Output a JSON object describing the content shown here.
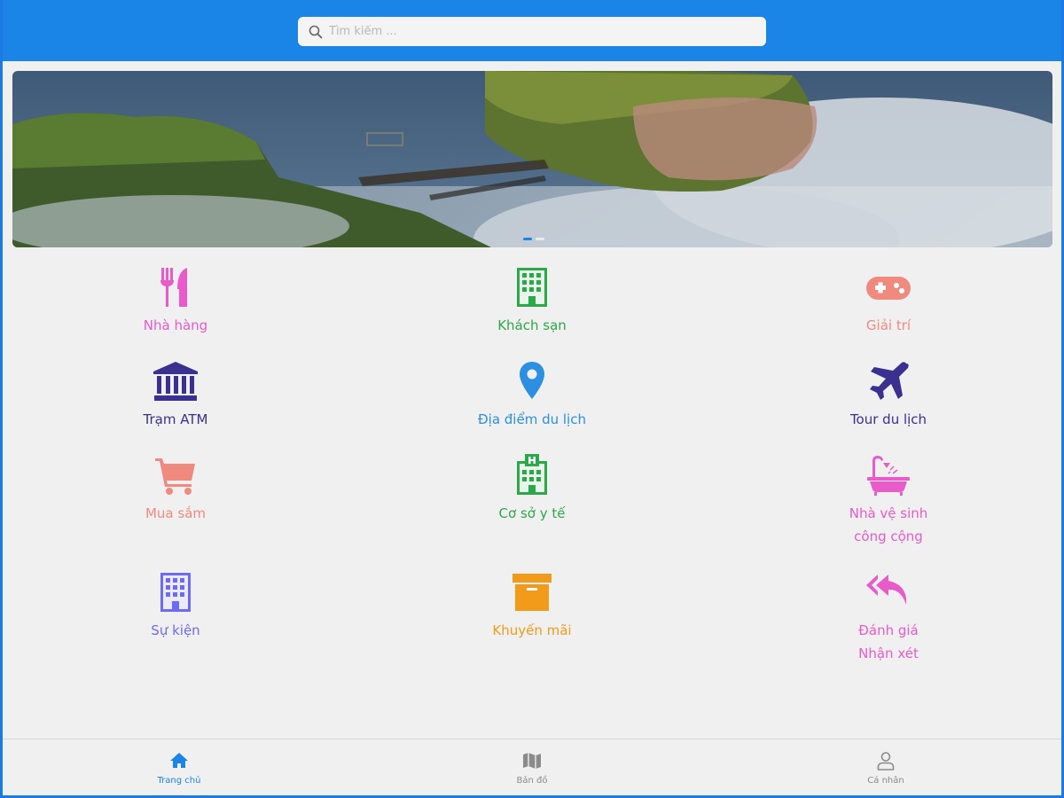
{
  "search": {
    "placeholder": "Tìm kiếm ..."
  },
  "banner": {
    "slide_count": 2,
    "active_slide": 1
  },
  "categories": [
    {
      "label": "Nhà hàng",
      "icon": "utensils-icon",
      "color": "#e85bc8"
    },
    {
      "label": "Khách sạn",
      "icon": "hotel-building-icon",
      "color": "#2ca84a"
    },
    {
      "label": "Giải trí",
      "icon": "gamepad-icon",
      "color": "#f08a7e"
    },
    {
      "label": "Trạm ATM",
      "icon": "bank-icon",
      "color": "#3b2f8f"
    },
    {
      "label": "Địa điểm du lịch",
      "icon": "map-pin-icon",
      "color": "#2c8fe0"
    },
    {
      "label": "Tour du lịch",
      "icon": "airplane-icon",
      "color": "#3b2f8f"
    },
    {
      "label": "Mua sắm",
      "icon": "shopping-cart-icon",
      "color": "#f08a7e"
    },
    {
      "label": "Cơ sở y tế",
      "icon": "hospital-icon",
      "color": "#2ca84a"
    },
    {
      "label": "Nhà vệ sinh\ncông cộng",
      "icon": "bathtub-icon",
      "color": "#e85bc8"
    },
    {
      "label": "Sự kiện",
      "icon": "event-building-icon",
      "color": "#6b6bf5"
    },
    {
      "label": "Khuyến mãi",
      "icon": "archive-box-icon",
      "color": "#f29a1a"
    },
    {
      "label": "Đánh giá\nNhận xét",
      "icon": "reply-all-icon",
      "color": "#e85bc8"
    }
  ],
  "bottom_nav": [
    {
      "label": "Trang chủ",
      "icon": "home-icon",
      "active": true
    },
    {
      "label": "Bản đồ",
      "icon": "map-icon",
      "active": false
    },
    {
      "label": "Cá nhân",
      "icon": "user-icon",
      "active": false
    }
  ],
  "colors": {
    "header": "#1b84e7",
    "nav_active": "#1b84e7",
    "nav_inactive": "#8a8a8a"
  }
}
